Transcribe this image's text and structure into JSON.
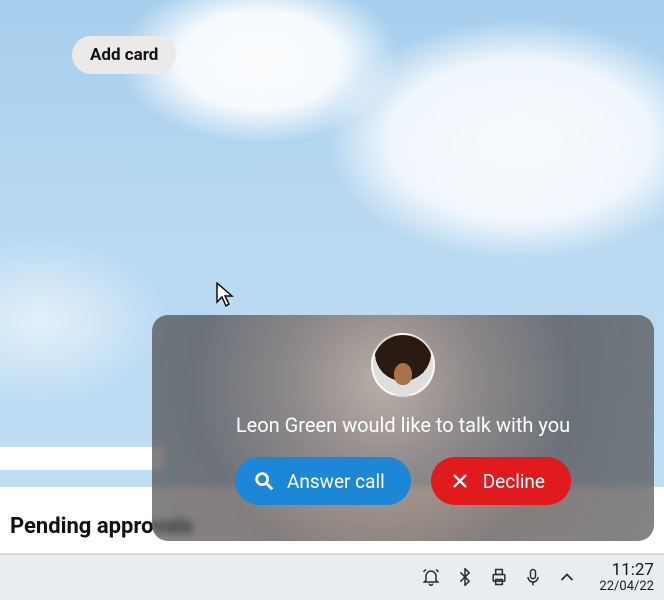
{
  "addCard": {
    "label": "Add card"
  },
  "pending": {
    "heading": "Pending approvals"
  },
  "call": {
    "caller": "Leon Green",
    "message": "Leon Green would like to talk with you",
    "answerLabel": "Answer call",
    "declineLabel": "Decline"
  },
  "taskbar": {
    "time": "11:27",
    "date": "22/04/22",
    "icons": {
      "notifications": "notification-bell-icon",
      "bluetooth": "bluetooth-icon",
      "printer": "printer-icon",
      "microphone": "microphone-icon",
      "overflow": "chevron-up-icon"
    }
  }
}
